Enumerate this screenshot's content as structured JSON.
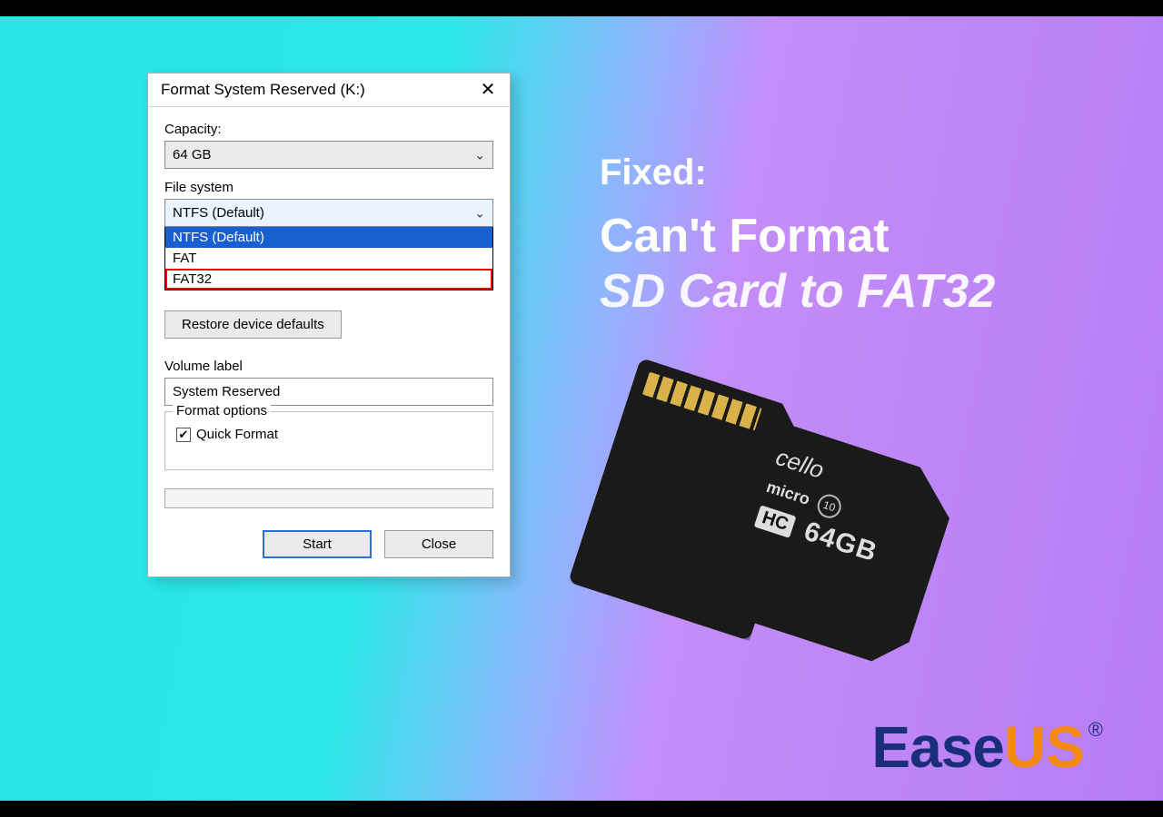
{
  "dialog": {
    "title": "Format System Reserved (K:)",
    "capacity_label": "Capacity:",
    "capacity_value": "64 GB",
    "filesystem_label": "File system",
    "filesystem_value": "NTFS (Default)",
    "filesystem_options": {
      "opt0": "NTFS (Default)",
      "opt1": "FAT",
      "opt2": "FAT32"
    },
    "restore_defaults": "Restore device defaults",
    "volume_label_label": "Volume label",
    "volume_label_value": "System Reserved",
    "format_options_label": "Format options",
    "quick_format_label": "Quick Format",
    "quick_format_checked": true,
    "start_label": "Start",
    "close_label": "Close"
  },
  "headline": {
    "line1": "Fixed:",
    "line2": "Can't Format",
    "line3": "SD Card to FAT32"
  },
  "sdcard": {
    "brand": "cello",
    "micro": "micro",
    "class": "10",
    "hc": "HC",
    "capacity": "64GB"
  },
  "logo": {
    "part1": "Ease",
    "part2": "US",
    "reg": "®"
  }
}
